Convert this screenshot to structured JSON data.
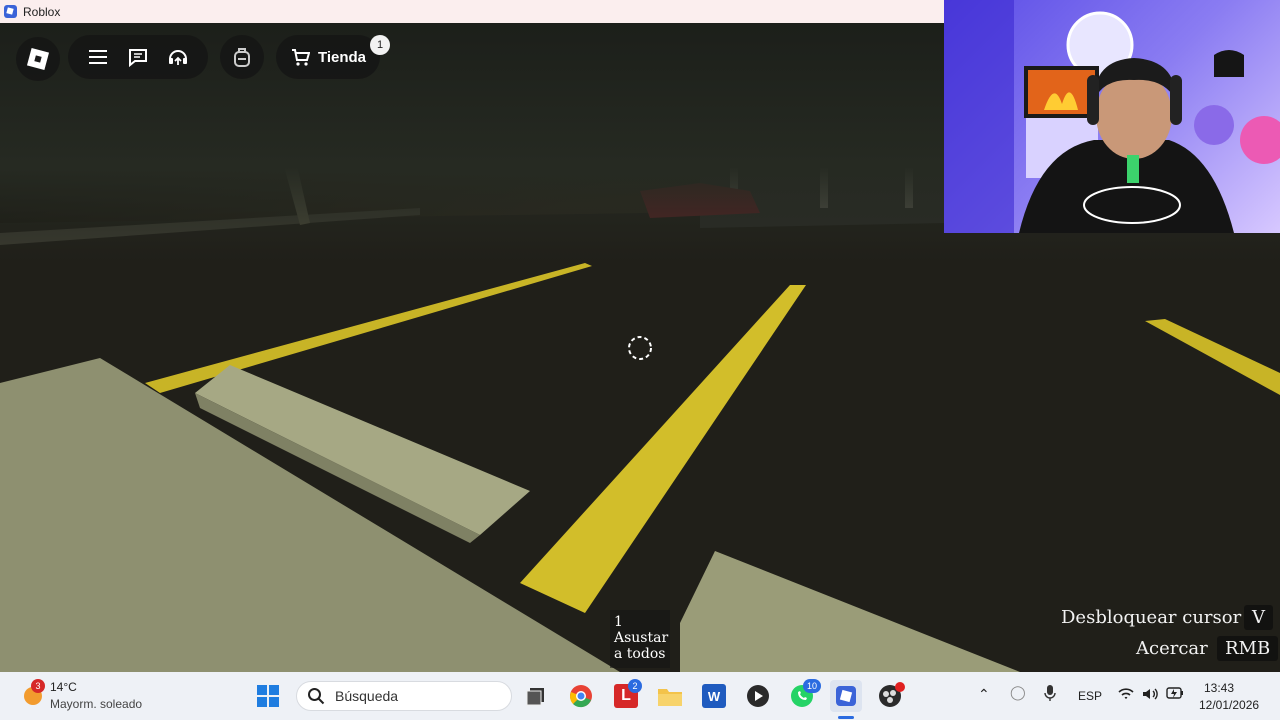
{
  "window": {
    "title": "Roblox"
  },
  "hud": {
    "shop_label": "Tienda",
    "shop_badge": "1",
    "icons": [
      "roblox-logo-icon",
      "menu-icon",
      "chat-icon",
      "voice-icon",
      "backpack-icon",
      "cart-icon"
    ]
  },
  "controls": [
    {
      "label": "Desbloquear cursor",
      "key": "V"
    },
    {
      "label": "Acercar",
      "key": "RMB"
    }
  ],
  "hotbar": {
    "slot": "1",
    "label": "Asustar a todos"
  },
  "taskbar": {
    "weather": {
      "temp": "14°C",
      "desc": "Mayorm. soleado",
      "badge": "3"
    },
    "search_placeholder": "Búsqueda",
    "badges": {
      "l_app": "2",
      "whatsapp": "10"
    },
    "language": "ESP",
    "time": "13:43",
    "date": "12/01/2026"
  },
  "colors": {
    "road_line": "#d8c22a",
    "concrete": "#9c9e7c",
    "asphalt": "#1e1d18",
    "taskbar": "#eef1f6"
  }
}
